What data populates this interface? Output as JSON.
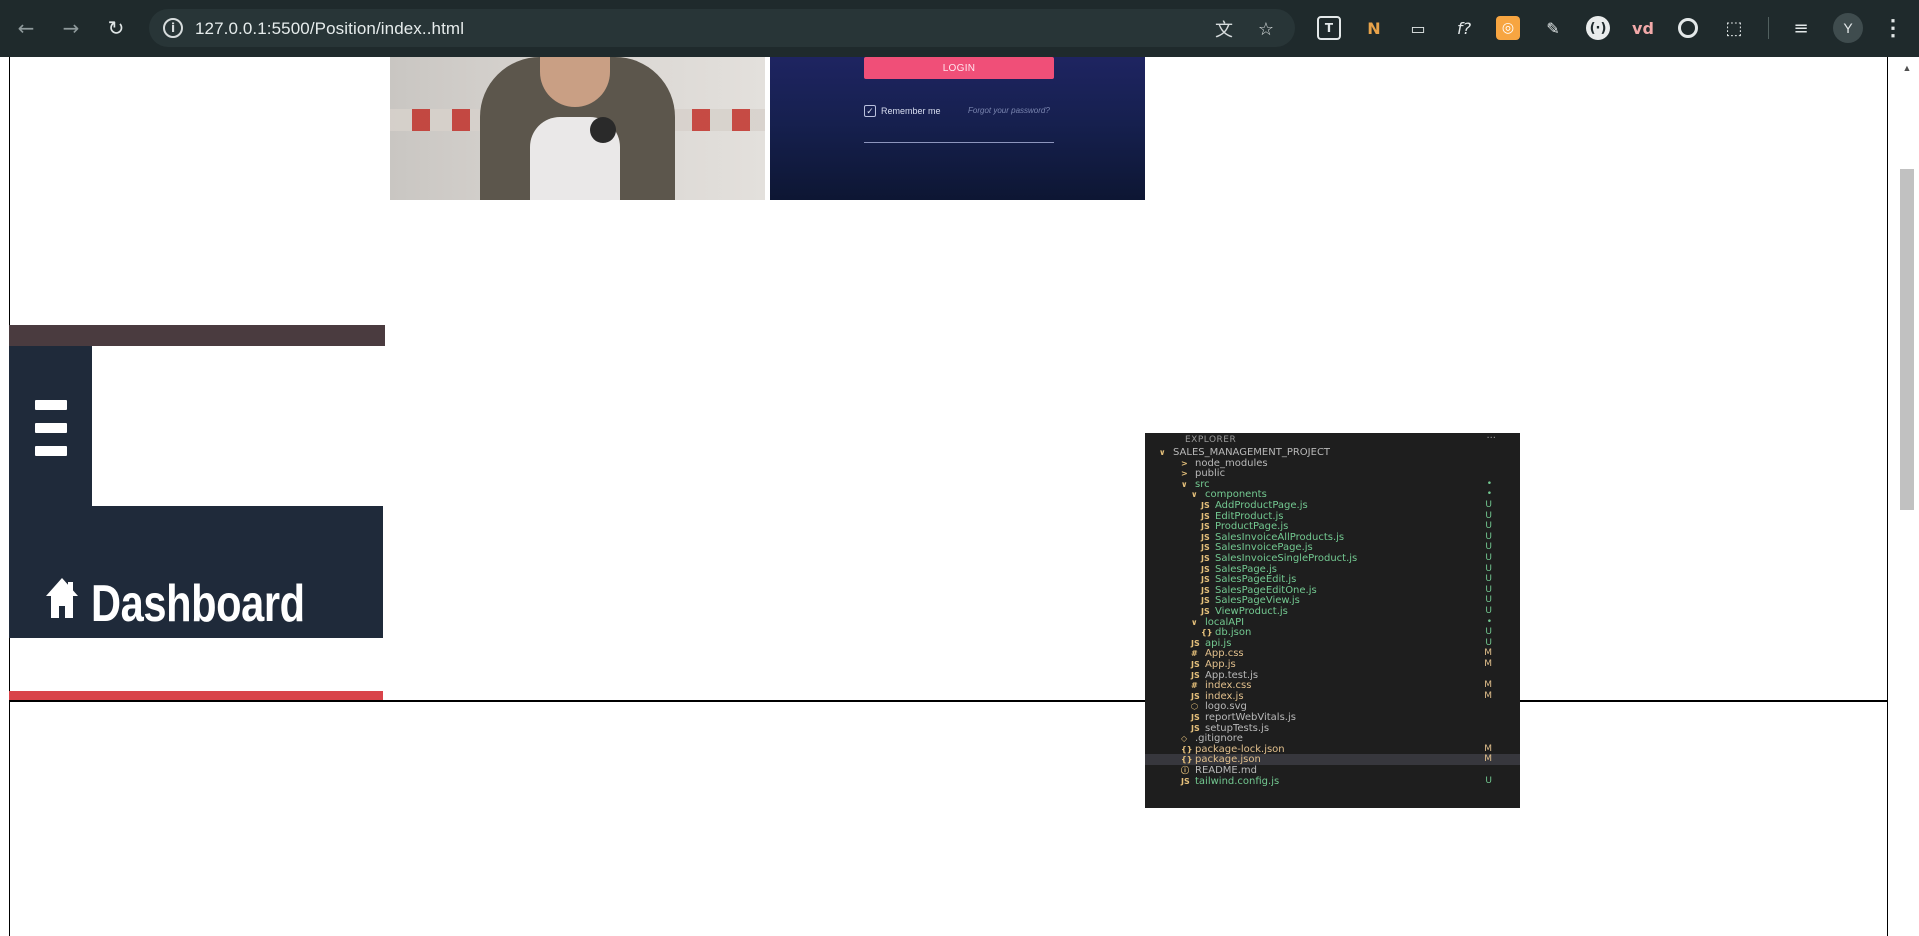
{
  "browser": {
    "url": "127.0.0.1:5500/Position/index..html",
    "profile_initial": "Y",
    "back_icon": "arrow-left-icon",
    "forward_icon": "arrow-right-icon",
    "reload_icon": "reload-icon",
    "extensions": [
      {
        "name": "translate-icon",
        "glyph": "文"
      },
      {
        "name": "bookmark-star-icon",
        "glyph": "☆"
      },
      {
        "name": "extension-t-icon",
        "glyph": "T"
      },
      {
        "name": "extension-n-icon",
        "glyph": "N"
      },
      {
        "name": "extension-image-icon",
        "glyph": "▭"
      },
      {
        "name": "extension-font-icon",
        "glyph": "f?"
      },
      {
        "name": "extension-orange-icon",
        "glyph": "◎"
      },
      {
        "name": "eyedropper-icon",
        "glyph": "✎"
      },
      {
        "name": "extension-circle-icon",
        "glyph": "(·)"
      },
      {
        "name": "extension-vd-icon",
        "glyph": "vd"
      },
      {
        "name": "extension-ring-icon",
        "glyph": "◉"
      },
      {
        "name": "extensions-puzzle-icon",
        "glyph": "⬚"
      },
      {
        "name": "media-queue-icon",
        "glyph": "≡"
      }
    ],
    "menu_glyph": "⋮"
  },
  "login_card": {
    "button_label": "LOGIN",
    "remember_label": "Remember me",
    "forgot_label": "Forgot your password?"
  },
  "dashboard": {
    "label": "Dashboard"
  },
  "explorer": {
    "header": "EXPLORER",
    "header_dots": "···",
    "rows": [
      {
        "ic": "∨",
        "name": "SALES_MANAGEMENT_PROJECT",
        "status": "",
        "kind": "plain"
      },
      {
        "ic": ">",
        "name": "node_modules",
        "status": "",
        "kind": "plain"
      },
      {
        "ic": ">",
        "name": "public",
        "status": "",
        "kind": "plain"
      },
      {
        "ic": "∨",
        "name": "src",
        "status": "•",
        "kind": "new"
      },
      {
        "ic": "∨",
        "name": "components",
        "status": "•",
        "kind": "new"
      },
      {
        "ic": "JS",
        "name": "AddProductPage.js",
        "status": "U",
        "kind": "new"
      },
      {
        "ic": "JS",
        "name": "EditProduct.js",
        "status": "U",
        "kind": "new"
      },
      {
        "ic": "JS",
        "name": "ProductPage.js",
        "status": "U",
        "kind": "new"
      },
      {
        "ic": "JS",
        "name": "SalesInvoiceAllProducts.js",
        "status": "U",
        "kind": "new"
      },
      {
        "ic": "JS",
        "name": "SalesInvoicePage.js",
        "status": "U",
        "kind": "new"
      },
      {
        "ic": "JS",
        "name": "SalesInvoiceSingleProduct.js",
        "status": "U",
        "kind": "new"
      },
      {
        "ic": "JS",
        "name": "SalesPage.js",
        "status": "U",
        "kind": "new"
      },
      {
        "ic": "JS",
        "name": "SalesPageEdit.js",
        "status": "U",
        "kind": "new"
      },
      {
        "ic": "JS",
        "name": "SalesPageEditOne.js",
        "status": "U",
        "kind": "new"
      },
      {
        "ic": "JS",
        "name": "SalesPageView.js",
        "status": "U",
        "kind": "new"
      },
      {
        "ic": "JS",
        "name": "ViewProduct.js",
        "status": "U",
        "kind": "new"
      },
      {
        "ic": "∨",
        "name": "localAPI",
        "status": "•",
        "kind": "new"
      },
      {
        "ic": "{}",
        "name": "db.json",
        "status": "U",
        "kind": "new"
      },
      {
        "ic": "JS",
        "name": "api.js",
        "status": "U",
        "kind": "new"
      },
      {
        "ic": "#",
        "name": "App.css",
        "status": "M",
        "kind": "mod"
      },
      {
        "ic": "JS",
        "name": "App.js",
        "status": "M",
        "kind": "mod"
      },
      {
        "ic": "JS",
        "name": "App.test.js",
        "status": "",
        "kind": "plain"
      },
      {
        "ic": "#",
        "name": "index.css",
        "status": "M",
        "kind": "mod"
      },
      {
        "ic": "JS",
        "name": "index.js",
        "status": "M",
        "kind": "mod"
      },
      {
        "ic": "⬡",
        "name": "logo.svg",
        "status": "",
        "kind": "plain"
      },
      {
        "ic": "JS",
        "name": "reportWebVitals.js",
        "status": "",
        "kind": "plain"
      },
      {
        "ic": "JS",
        "name": "setupTests.js",
        "status": "",
        "kind": "plain"
      },
      {
        "ic": "◇",
        "name": ".gitignore",
        "status": "",
        "kind": "plain"
      },
      {
        "ic": "{}",
        "name": "package-lock.json",
        "status": "M",
        "kind": "mod"
      },
      {
        "ic": "{}",
        "name": "package.json",
        "status": "M",
        "kind": "mod"
      },
      {
        "ic": "ⓘ",
        "name": "README.md",
        "status": "",
        "kind": "plain"
      },
      {
        "ic": "JS",
        "name": "tailwind.config.js",
        "status": "U",
        "kind": "new"
      }
    ]
  },
  "colors": {
    "toolbar": "#1f2a2c",
    "omnibox": "#283537",
    "login_accent": "#f04f78",
    "dashboard_panel": "#1f2a3a",
    "dashboard_red": "#d9444a"
  }
}
